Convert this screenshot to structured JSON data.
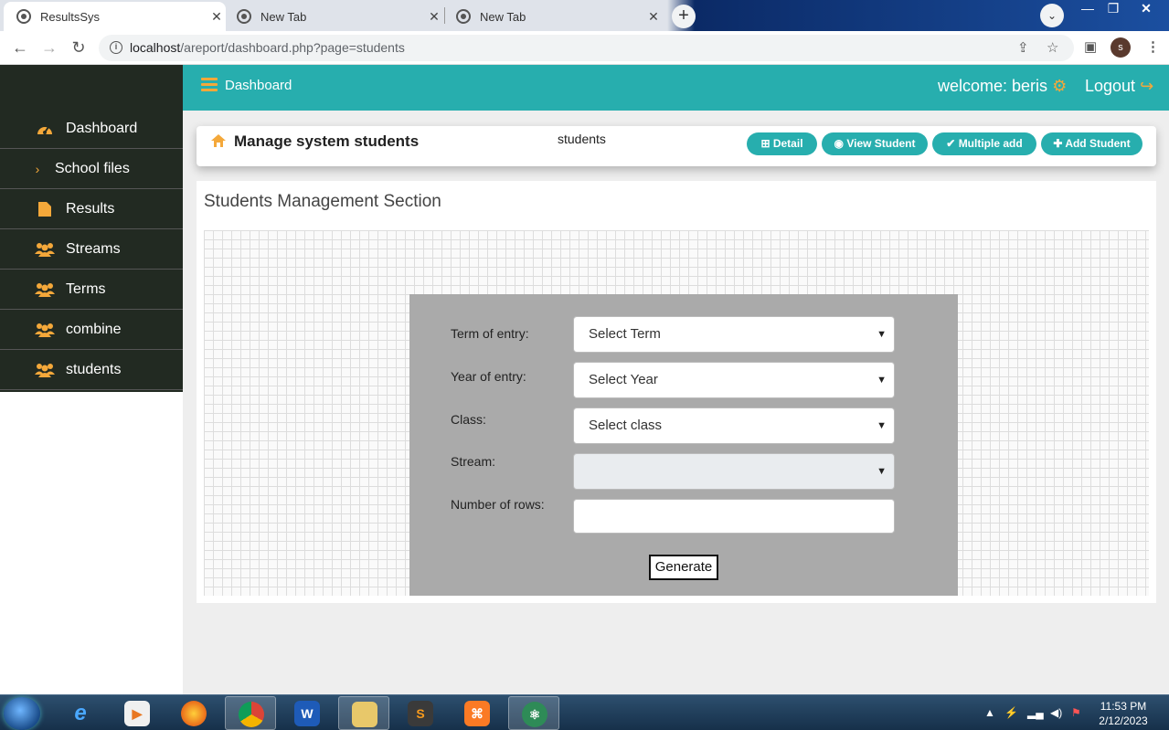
{
  "browser": {
    "tabs": [
      {
        "label": "ResultsSys",
        "active": true
      },
      {
        "label": "New Tab",
        "active": false
      },
      {
        "label": "New Tab",
        "active": false
      }
    ],
    "url_host": "localhost",
    "url_path": "/areport/dashboard.php?page=students",
    "profile_initial": "s"
  },
  "sidebar": {
    "items": [
      {
        "label": "Dashboard",
        "icon": "dashboard-icon"
      },
      {
        "label": "School files",
        "icon": "chevron-right-icon"
      },
      {
        "label": "Results",
        "icon": "file-icon"
      },
      {
        "label": "Streams",
        "icon": "users-icon"
      },
      {
        "label": "Terms",
        "icon": "users-icon"
      },
      {
        "label": "combine",
        "icon": "users-icon"
      },
      {
        "label": "students",
        "icon": "users-icon"
      }
    ]
  },
  "header": {
    "title": "Dashboard",
    "welcome": "welcome: beris",
    "logout": "Logout"
  },
  "page": {
    "title": "Manage system students",
    "breadcrumb": "students",
    "buttons": {
      "detail": "Detail",
      "view": "View Student",
      "multiple": "Multiple add",
      "add": "Add Student"
    },
    "section_title": "Students Management Section"
  },
  "form": {
    "term_label": "Term of entry:",
    "term_value": "Select Term",
    "year_label": "Year of entry:",
    "year_value": "Select Year",
    "class_label": "Class:",
    "class_value": "Select class",
    "stream_label": "Stream:",
    "stream_value": "",
    "rows_label": "Number of rows:",
    "rows_value": "",
    "generate": "Generate"
  },
  "taskbar": {
    "time": "11:53 PM",
    "date": "2/12/2023"
  },
  "colors": {
    "header": "#27aeae",
    "sidebar": "#222a22",
    "accent": "#f4a83a",
    "form_panel": "#aaaaaa"
  }
}
